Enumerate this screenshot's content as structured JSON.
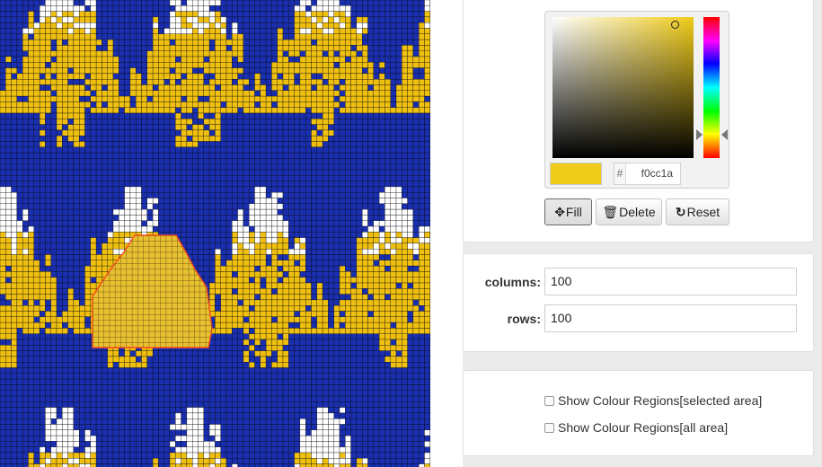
{
  "pattern": {
    "columns": 100,
    "rows": 100,
    "colors": {
      "background": "#1a2fb0",
      "primary": "#f0c010",
      "secondary": "#ffffff",
      "grid_line": "#0a0a0a",
      "selection_fill": "#e8c030",
      "selection_border": "#ff4a1a"
    }
  },
  "color_picker": {
    "hex_prefix": "#",
    "hex_value": "f0cc1a",
    "current_color": "#f0cc1a"
  },
  "toolbar": {
    "fill_label": "Fill",
    "delete_label": "Delete",
    "reset_label": "Reset"
  },
  "size": {
    "columns_label": "columns:",
    "columns_value": "100",
    "rows_label": "rows:",
    "rows_value": "100"
  },
  "regions": {
    "selected_label": "Show Colour Regions[selected area]",
    "all_label": "Show Colour Regions[all area]"
  }
}
